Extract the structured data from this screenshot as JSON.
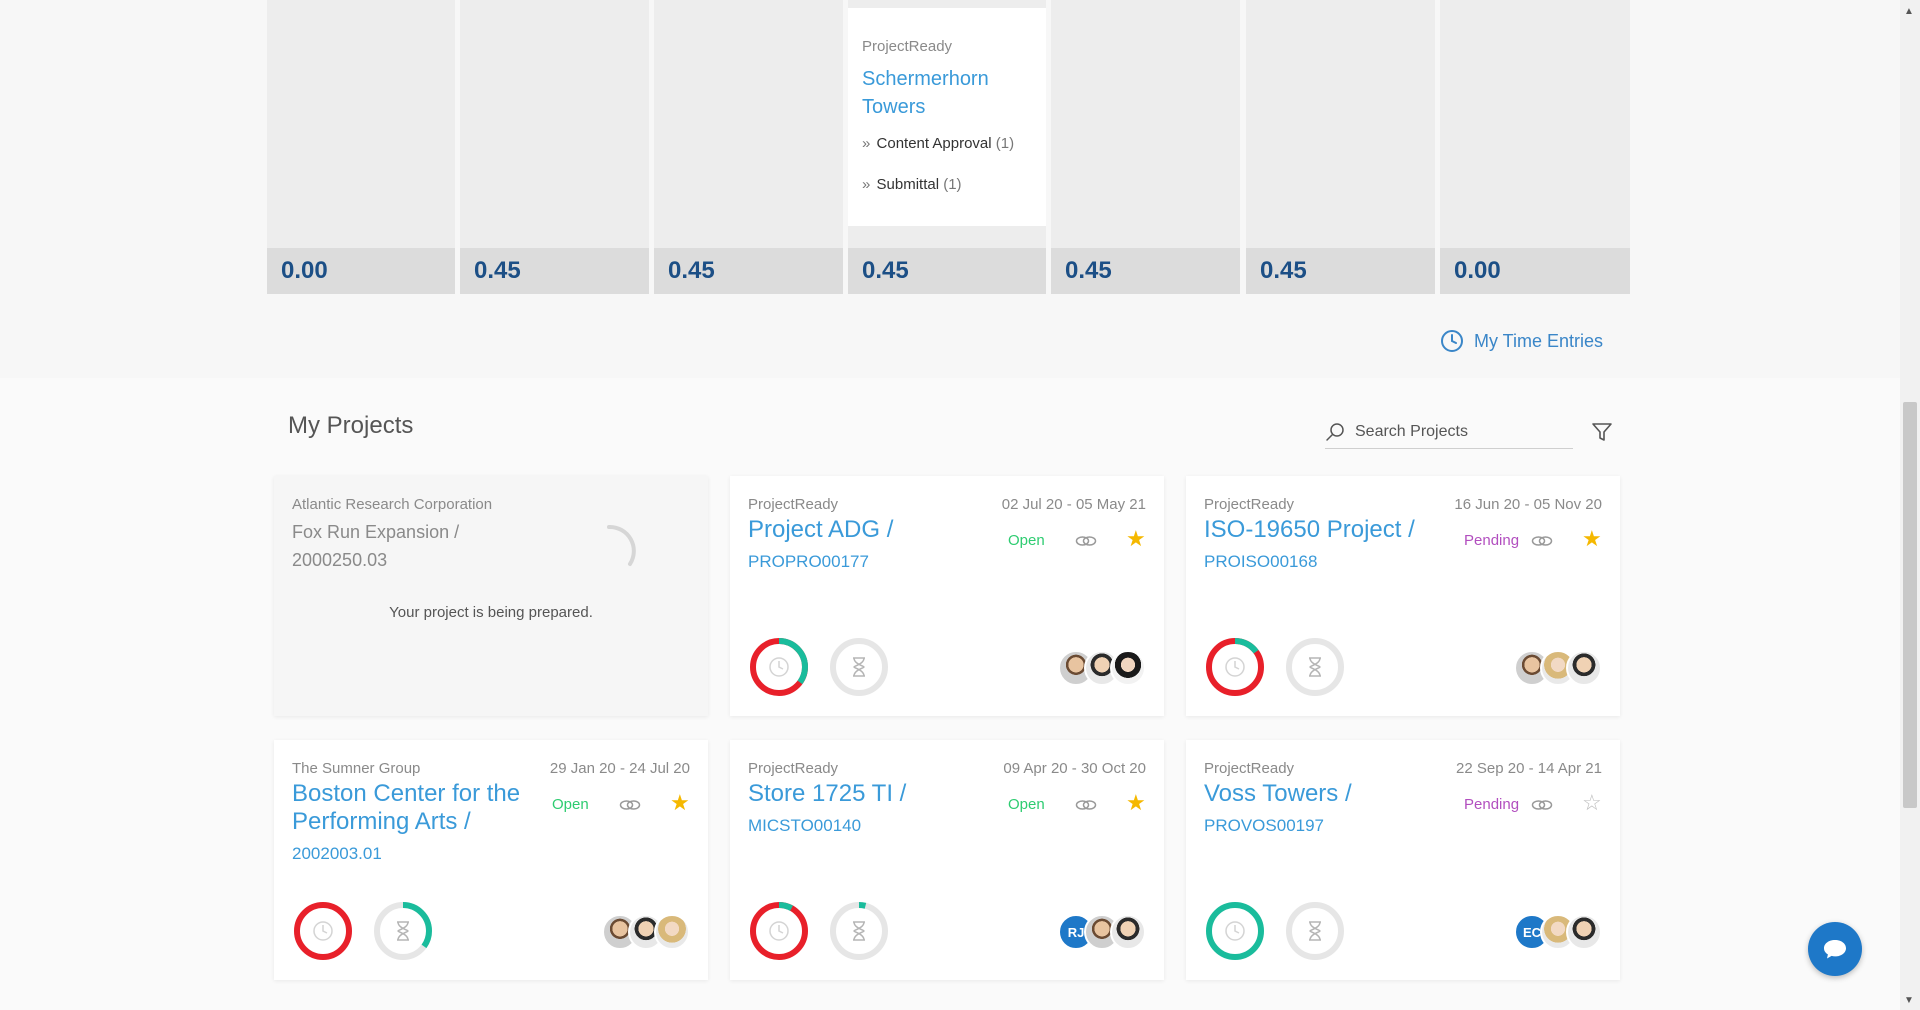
{
  "timesheet": {
    "columns": [
      {
        "total": "0.00"
      },
      {
        "total": "0.45"
      },
      {
        "total": "0.45"
      },
      {
        "total": "0.45",
        "card": {
          "org": "ProjectReady",
          "project": "Schermerhorn Towers",
          "tasks": [
            {
              "label": "Content Approval",
              "count": "(1)"
            },
            {
              "label": "Submittal",
              "count": "(1)"
            }
          ]
        }
      },
      {
        "total": "0.45"
      },
      {
        "total": "0.45"
      },
      {
        "total": "0.00"
      }
    ],
    "my_time_entries": "My Time Entries"
  },
  "projects_section": {
    "title": "My Projects",
    "search_placeholder": "Search Projects"
  },
  "projects": [
    {
      "org": "Atlantic Research Corporation",
      "name": "Fox Run Expansion /",
      "code": "2000250.03",
      "preparing_text": "Your project is being prepared."
    },
    {
      "org": "ProjectReady",
      "dates": "02 Jul 20 - 05 May 21",
      "name": "Project ADG /",
      "code": "PROPRO00177",
      "status": "Open",
      "starred": true,
      "time_fraction": 0.35,
      "time_color": "#e8202a",
      "hours_fraction": 0
    },
    {
      "org": "ProjectReady",
      "dates": "16 Jun 20 - 05 Nov 20",
      "name": "ISO-19650 Project /",
      "code": "PROISO00168",
      "status": "Pending",
      "starred": true,
      "time_fraction": 0.15,
      "time_color": "#e8202a",
      "hours_fraction": 0
    },
    {
      "org": "The Sumner Group",
      "dates": "29 Jan 20 - 24 Jul 20",
      "name": "Boston Center for the Performing Arts /",
      "code": "2002003.01",
      "status": "Open",
      "starred": true,
      "time_fraction": 0,
      "time_color": "#e8202a",
      "hours_fraction": 0.35
    },
    {
      "org": "ProjectReady",
      "dates": "09 Apr 20 - 30 Oct 20",
      "name": "Store 1725 TI /",
      "code": "MICSTO00140",
      "status": "Open",
      "starred": true,
      "time_fraction": 0.08,
      "time_color": "#e8202a",
      "hours_fraction": 0.04,
      "avatar_initials": "RJ"
    },
    {
      "org": "ProjectReady",
      "dates": "22 Sep 20 - 14 Apr 21",
      "name": "Voss Towers /",
      "code": "PROVOS00197",
      "status": "Pending",
      "starred": false,
      "time_fraction": 1,
      "time_color": "#1abc9c",
      "hours_fraction": 0,
      "avatar_initials": "EC"
    }
  ],
  "colors": {
    "accent": "#3a9ad9",
    "open": "#2ecc71",
    "pending": "#b24fbf",
    "ring_red": "#e8202a",
    "ring_teal": "#1abc9c",
    "star": "#f5b800"
  }
}
